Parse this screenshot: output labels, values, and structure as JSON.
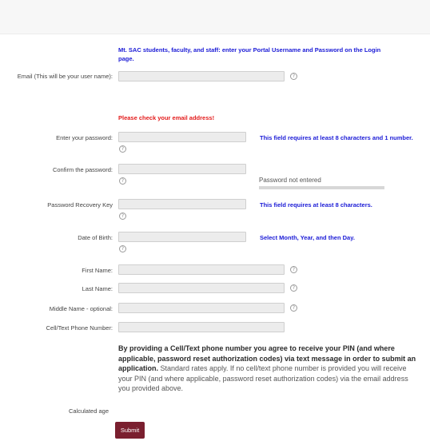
{
  "notice": "Mt. SAC students, faculty, and staff: enter your Portal Username and Password on the Login page.",
  "fields": {
    "email": {
      "label": "Email (This will be your user name):",
      "value": ""
    },
    "password": {
      "label": "Enter your password:",
      "value": "",
      "hint": "This field requires at least 8 characters and 1 number."
    },
    "confirm_password": {
      "label": "Confirm the password:",
      "value": ""
    },
    "recovery_key": {
      "label": "Password Recovery Key",
      "value": "",
      "hint": "This field requires at least 8 characters."
    },
    "dob": {
      "label": "Date of Birth:",
      "value": "",
      "hint": "Select Month, Year, and then Day."
    },
    "first_name": {
      "label": "First Name:",
      "value": ""
    },
    "last_name": {
      "label": "Last Name:",
      "value": ""
    },
    "middle_name": {
      "label": "Middle Name - optional:",
      "value": ""
    },
    "phone": {
      "label": "Cell/Text Phone Number:",
      "value": ""
    }
  },
  "email_error": "Please check your email address!",
  "password_status": "Password not entered",
  "help_glyph": "?",
  "disclaimer": {
    "bold": "By providing a Cell/Text phone number you agree to receive your PIN (and where applicable, password reset authorization codes) via text message in order to submit an application.",
    "normal": " Standard rates apply.  If no cell/text phone number is provided you will receive your PIN (and where applicable, password reset authorization codes) via the email address you provided above."
  },
  "calculated_age_label": "Calculated age",
  "submit_label": "Submit",
  "colors": {
    "accent": "#7a1f2f",
    "hint": "#1a1ad6",
    "error": "#e31b1b"
  }
}
